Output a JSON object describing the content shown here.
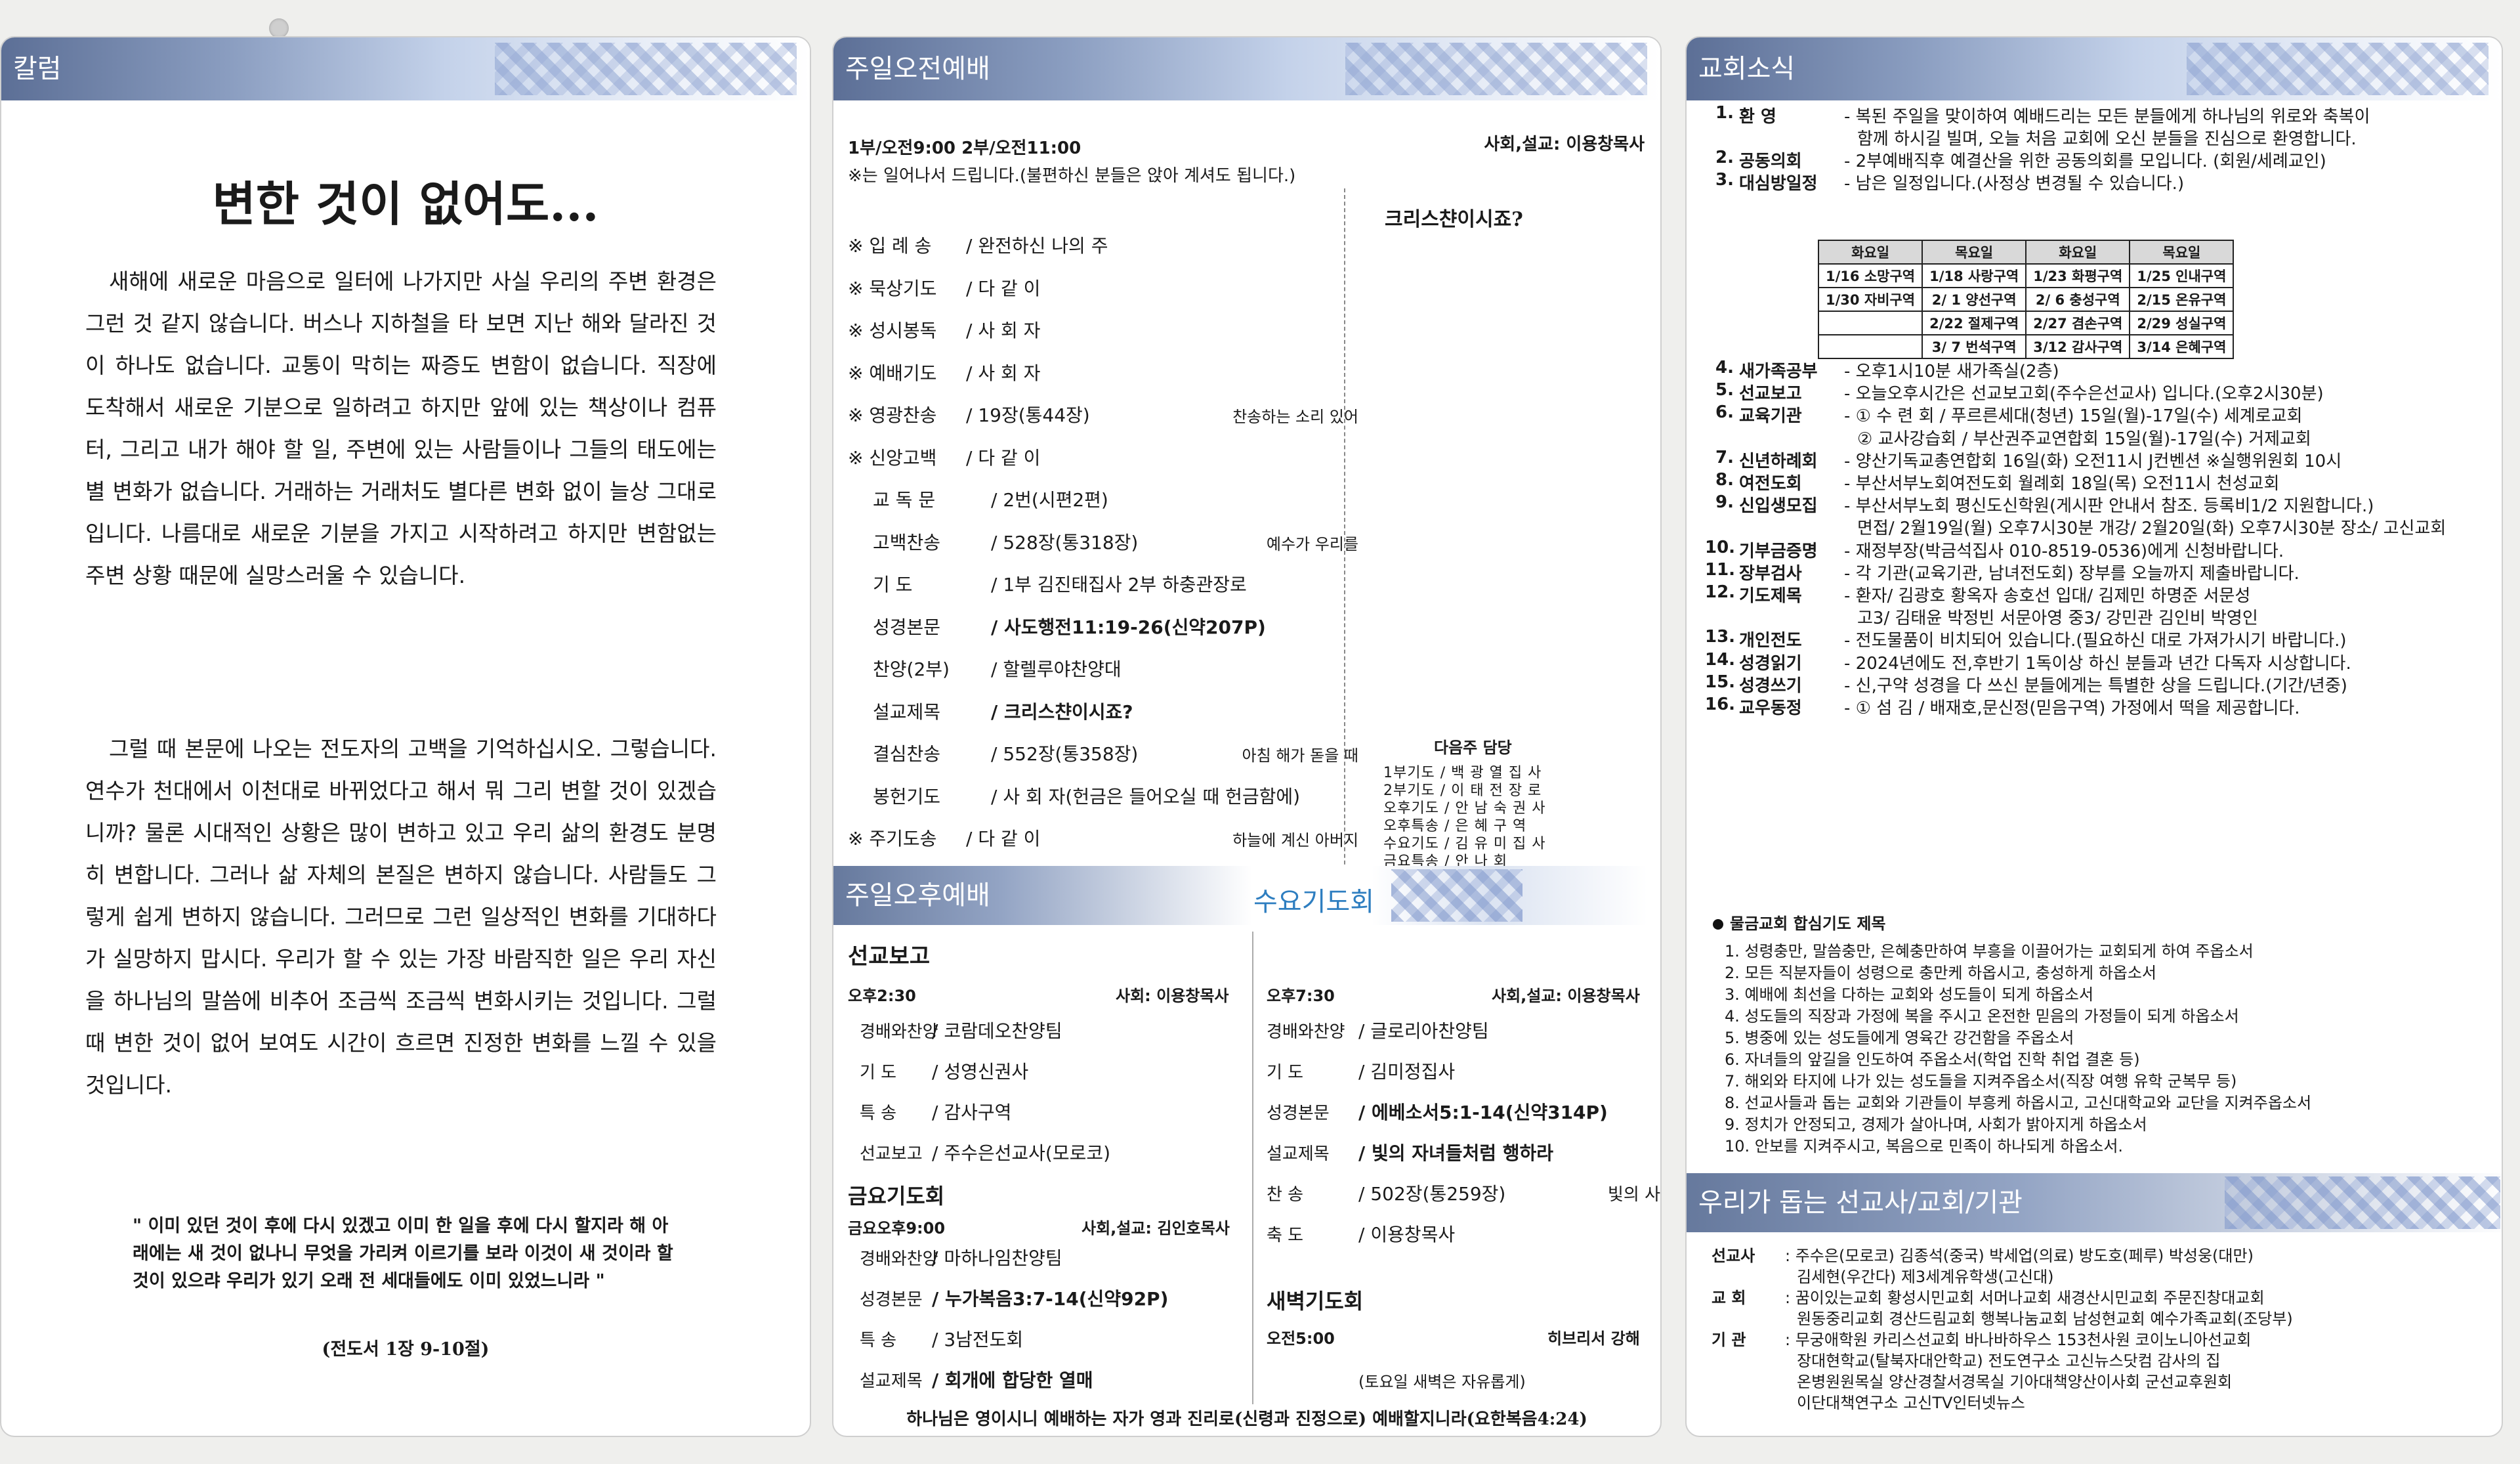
{
  "column": {
    "header": "칼럼",
    "title": "변한 것이 없어도...",
    "p1": "새해에 새로운 마음으로 일터에 나가지만 사실 우리의 주변 환경은 그런 것 같지 않습니다. 버스나 지하철을 타 보면 지난 해와 달라진 것이 하나도 없습니다. 교통이 막히는 짜증도 변함이 없습니다. 직장에 도착해서 새로운 기분으로 일하려고 하지만 앞에 있는 책상이나 컴퓨터, 그리고 내가 해야 할 일, 주변에 있는 사람들이나 그들의 태도에는 별 변화가 없습니다. 거래하는 거래처도 별다른 변화 없이 늘상 그대로입니다. 나름대로 새로운 기분을 가지고 시작하려고 하지만 변함없는 주변 상황 때문에 실망스러울 수 있습니다.",
    "p2": "그럴 때 본문에 나오는 전도자의 고백을 기억하십시오. 그렇습니다. 연수가 천대에서 이천대로 바뀌었다고 해서 뭐 그리 변할 것이 있겠습니까? 물론 시대적인 상황은 많이 변하고 있고 우리 삶의 환경도 분명히 변합니다. 그러나 삶 자체의 본질은 변하지 않습니다. 사람들도 그렇게 쉽게 변하지 않습니다. 그러므로 그런 일상적인 변화를 기대하다가 실망하지 맙시다. 우리가 할 수 있는 가장 바람직한 일은 우리 자신을 하나님의 말씀에 비추어 조금씩 조금씩 변화시키는 것입니다. 그럴 때 변한 것이 없어 보여도 시간이 흐르면 진정한 변화를 느낄 수 있을 것입니다.",
    "quote": "\" 이미 있던 것이 후에 다시 있겠고 이미 한 일을 후에 다시 할지라 해 아래에는 새 것이 없나니 무엇을 가리켜 이르기를 보라 이것이 새 것이라 할 것이 있으랴 우리가 있기 오래 전 세대들에도 이미 있었느니라 \"",
    "ref": "(전도서 1장 9-10절)"
  },
  "morning": {
    "header": "주일오전예배",
    "times": "1부/오전9:00  2부/오전11:00",
    "host": "사회,설교: 이용창목사",
    "note": "※는 일어나서 드립니다.(불편하신 분들은 앉아 계셔도 됩니다.)",
    "rows": [
      {
        "label": "※ 입 례 송",
        "value": "/ 완전하신 나의 주",
        "extra": ""
      },
      {
        "label": "※ 묵상기도",
        "value": "/ 다 같 이",
        "extra": ""
      },
      {
        "label": "※ 성시봉독",
        "value": "/ 사 회 자",
        "extra": ""
      },
      {
        "label": "※ 예배기도",
        "value": "/ 사 회 자",
        "extra": ""
      },
      {
        "label": "※ 영광찬송",
        "value": "/ 19장(통44장)",
        "extra": "찬송하는 소리 있어"
      },
      {
        "label": "※ 신앙고백",
        "value": "/ 다 같 이",
        "extra": ""
      },
      {
        "label": "교 독 문",
        "value": "/ 2번(시편2편)",
        "extra": ""
      },
      {
        "label": "고백찬송",
        "value": "/ 528장(통318장)",
        "extra": "예수가 우리를"
      },
      {
        "label": "기     도",
        "value": "/ 1부 김진태집사   2부 하충관장로",
        "extra": ""
      },
      {
        "label": "성경본문",
        "value": "/ 사도행전11:19-26(신약207P)",
        "extra": ""
      },
      {
        "label": "찬양(2부)",
        "value": "/ 할렐루야찬양대",
        "extra": ""
      },
      {
        "label": "설교제목",
        "value": "/ 크리스챤이시죠?",
        "extra": ""
      },
      {
        "label": "결심찬송",
        "value": "/ 552장(통358장)",
        "extra": "아침 해가 돋을 때"
      },
      {
        "label": "봉헌기도",
        "value": "/ 사 회 자(헌금은 들어오실 때 헌금함에)",
        "extra": ""
      },
      {
        "label": "※ 주기도송",
        "value": "/ 다 같 이",
        "extra": "하늘에 계신 아버지"
      },
      {
        "label": "※ 축     도",
        "value": "/ 이용창목사",
        "extra": ""
      }
    ],
    "sermon_title": "크리스챤이시죠?",
    "next_title": "다음주 담당",
    "next": [
      "1부기도 / 백 광 열 집 사",
      "2부기도 / 이 태 전 장 로",
      "오후기도 / 안 남 숙 권 사",
      "오후특송 / 은 혜 구 역",
      "수요기도 / 김 유 미 집 사",
      "금요특송 / 안     나     회"
    ]
  },
  "afternoon": {
    "header": "주일오후예배",
    "title": "선교보고",
    "time": "오후2:30",
    "host": "사회: 이용창목사",
    "rows": [
      {
        "label": "경배와찬양",
        "value": "/ 코람데오찬양팀"
      },
      {
        "label": "기    도",
        "value": "/ 성영신권사"
      },
      {
        "label": "특    송",
        "value": "/ 감사구역"
      },
      {
        "label": "선교보고",
        "value": "/ 주수은선교사(모로코)"
      }
    ],
    "friday_title": "금요기도회",
    "friday_time": "금요오후9:00",
    "friday_host": "사회,설교: 김인호목사",
    "friday_rows": [
      {
        "label": "경배와찬양",
        "value": "/ 마하나임찬양팀"
      },
      {
        "label": "성경본문",
        "value": "/ 누가복음3:7-14(신약92P)"
      },
      {
        "label": "특    송",
        "value": "/ 3남전도회"
      },
      {
        "label": "설교제목",
        "value": "/ 회개에 합당한 열매"
      }
    ]
  },
  "wednesday": {
    "header": "수요기도회",
    "time": "오후7:30",
    "host": "사회,설교: 이용창목사",
    "rows": [
      {
        "label": "경배와찬양",
        "value": "/ 글로리아찬양팀",
        "extra": ""
      },
      {
        "label": "기    도",
        "value": "/ 김미정집사",
        "extra": ""
      },
      {
        "label": "성경본문",
        "value": "/ 에베소서5:1-14(신약314P)",
        "extra": ""
      },
      {
        "label": "설교제목",
        "value": "/ 빛의 자녀들처럼 행하라",
        "extra": ""
      },
      {
        "label": "찬    송",
        "value": "/ 502장(통259장)",
        "extra": "빛의 사자들이여"
      },
      {
        "label": "축    도",
        "value": "/ 이용창목사",
        "extra": ""
      }
    ],
    "dawn_title": "새벽기도회",
    "dawn_time": "오전5:00",
    "dawn_book": "히브리서 강해",
    "dawn_note": "(토요일 새벽은 자유롭게)"
  },
  "footer_verse": "하나님은 영이시니 예배하는 자가 영과 진리로(신령과 진정으로) 예배할지니라(요한복음4:24)",
  "news": {
    "header": "교회소식",
    "items": [
      {
        "num": "1.",
        "label": "환      영",
        "text": "- 복된 주일을 맞이하여 예배드리는 모든 분들에게 하나님의 위로와 축복이"
      },
      {
        "num": "",
        "label": "",
        "text": "함께 하시길 빌며, 오늘 처음 교회에 오신 분들을 진심으로 환영합니다."
      },
      {
        "num": "2.",
        "label": "공동의회",
        "text": "- 2부예배직후 예결산을 위한 공동의회를 모입니다. (회원/세례교인)"
      },
      {
        "num": "3.",
        "label": "대심방일정",
        "text": "- 남은 일정입니다.(사정상 변경될 수 있습니다.)"
      }
    ],
    "cal_headers": [
      "화요일",
      "목요일",
      "화요일",
      "목요일"
    ],
    "cal_rows": [
      [
        "1/16 소망구역",
        "1/18 사랑구역",
        "1/23 화평구역",
        "1/25 인내구역"
      ],
      [
        "1/30 자비구역",
        "2/ 1 양선구역",
        "2/ 6 충성구역",
        "2/15 온유구역"
      ],
      [
        "",
        "2/22 절제구역",
        "2/27 겸손구역",
        "2/29 성실구역"
      ],
      [
        "",
        "3/ 7 번석구역",
        "3/12 감사구역",
        "3/14 은혜구역"
      ]
    ],
    "items2": [
      {
        "num": "4.",
        "label": "새가족공부",
        "text": "- 오후1시10분 새가족실(2층)"
      },
      {
        "num": "5.",
        "label": "선교보고",
        "text": "- 오늘오후시간은 선교보고회(주수은선교사) 입니다.(오후2시30분)"
      },
      {
        "num": "6.",
        "label": "교육기관",
        "text": "- ① 수  련  회 / 푸르른세대(청년)  15일(월)-17일(수) 세계로교회"
      },
      {
        "num": "",
        "label": "",
        "text": "② 교사강습회 / 부산권주교연합회 15일(월)-17일(수) 거제교회"
      },
      {
        "num": "7.",
        "label": "신년하례회",
        "text": "- 양산기독교총연합회 16일(화) 오전11시 J컨벤션 ※실행위원회 10시"
      },
      {
        "num": "8.",
        "label": "여전도회",
        "text": "- 부산서부노회여전도회 월례회 18일(목) 오전11시 천성교회"
      },
      {
        "num": "9.",
        "label": "신입생모집",
        "text": "- 부산서부노회 평신도신학원(게시판 안내서 참조. 등록비1/2 지원합니다.)"
      },
      {
        "num": "",
        "label": "",
        "text": "면접/ 2월19일(월) 오후7시30분 개강/ 2월20일(화) 오후7시30분 장소/ 고신교회"
      },
      {
        "num": "10.",
        "label": "기부금증명",
        "text": "- 재정부장(박금석집사 010-8519-0536)에게 신청바랍니다."
      },
      {
        "num": "11.",
        "label": "장부검사",
        "text": "- 각 기관(교육기관, 남녀전도회) 장부를 오늘까지 제출바랍니다."
      },
      {
        "num": "12.",
        "label": "기도제목",
        "text": "- 환자/ 김광호 황옥자 송호선                입대/ 김제민 하명준 서문성"
      },
      {
        "num": "",
        "label": "",
        "text": "고3/ 김태윤 박정빈 서문아영               중3/ 강민관 김인비 박영인"
      },
      {
        "num": "13.",
        "label": "개인전도",
        "text": "- 전도물품이 비치되어 있습니다.(필요하신 대로 가져가시기 바랍니다.)"
      },
      {
        "num": "14.",
        "label": "성경읽기",
        "text": "- 2024년에도 전,후반기 1독이상 하신 분들과 년간 다독자 시상합니다."
      },
      {
        "num": "15.",
        "label": "성경쓰기",
        "text": "- 신,구약 성경을 다 쓰신 분들에게는 특별한 상을 드립니다.(기간/년중)"
      },
      {
        "num": "16.",
        "label": "교우동정",
        "text": "- ① 섬 김 / 배재호,문신정(믿음구역) 가정에서 떡을 제공합니다."
      }
    ],
    "prayer_title": "물금교회 합심기도 제목",
    "prayers": [
      "1. 성령충만, 말씀충만, 은혜충만하여 부흥을 이끌어가는 교회되게 하여 주옵소서",
      "2. 모든 직분자들이 성령으로 충만케 하옵시고, 충성하게 하옵소서",
      "3. 예배에 최선을 다하는 교회와 성도들이 되게 하옵소서",
      "4. 성도들의 직장과 가정에 복을 주시고 온전한 믿음의 가정들이 되게 하옵소서",
      "5. 병중에 있는 성도들에게 영육간 강건함을 주옵소서",
      "6. 자녀들의 앞길을 인도하여 주옵소서(학업 진학 취업 결혼 등)",
      "7. 해외와 타지에 나가 있는 성도들을 지켜주옵소서(직장 여행 유학 군복무 등)",
      "8. 선교사들과 돕는 교회와 기관들이 부흥케 하옵시고, 고신대학교와 교단을 지켜주옵소서",
      "9. 정치가 안정되고, 경제가 살아나며, 사회가 밝아지게 하옵소서",
      "10. 안보를 지켜주시고, 복음으로 민족이 하나되게 하옵소서."
    ]
  },
  "support": {
    "header": "우리가 돕는 선교사/교회/기관",
    "rows": [
      {
        "label": "선교사",
        "text": ": 주수은(모로코) 김종석(중국) 박세업(의료) 방도호(페루) 박성웅(대만)"
      },
      {
        "label": "",
        "text": "김세현(우간다) 제3세계유학생(고신대)"
      },
      {
        "label": "교    회",
        "text": ": 꿈이있는교회 황성시민교회 서머나교회 새경산시민교회 주문진창대교회"
      },
      {
        "label": "",
        "text": "원동중리교회 경산드림교회 행복나눔교회 남성현교회 예수가족교회(조당부)"
      },
      {
        "label": "기    관",
        "text": ": 무궁애학원 카리스선교회 바나바하우스 153천사원 코이노니아선교회"
      },
      {
        "label": "",
        "text": "장대현학교(탈북자대안학교)  전도연구소 고신뉴스닷컴 감사의 집"
      },
      {
        "label": "",
        "text": "온병원원목실 양산경찰서경목실 기아대책양산이사회 군선교후원회"
      },
      {
        "label": "",
        "text": "이단대책연구소 고신TV인터넷뉴스"
      }
    ]
  }
}
